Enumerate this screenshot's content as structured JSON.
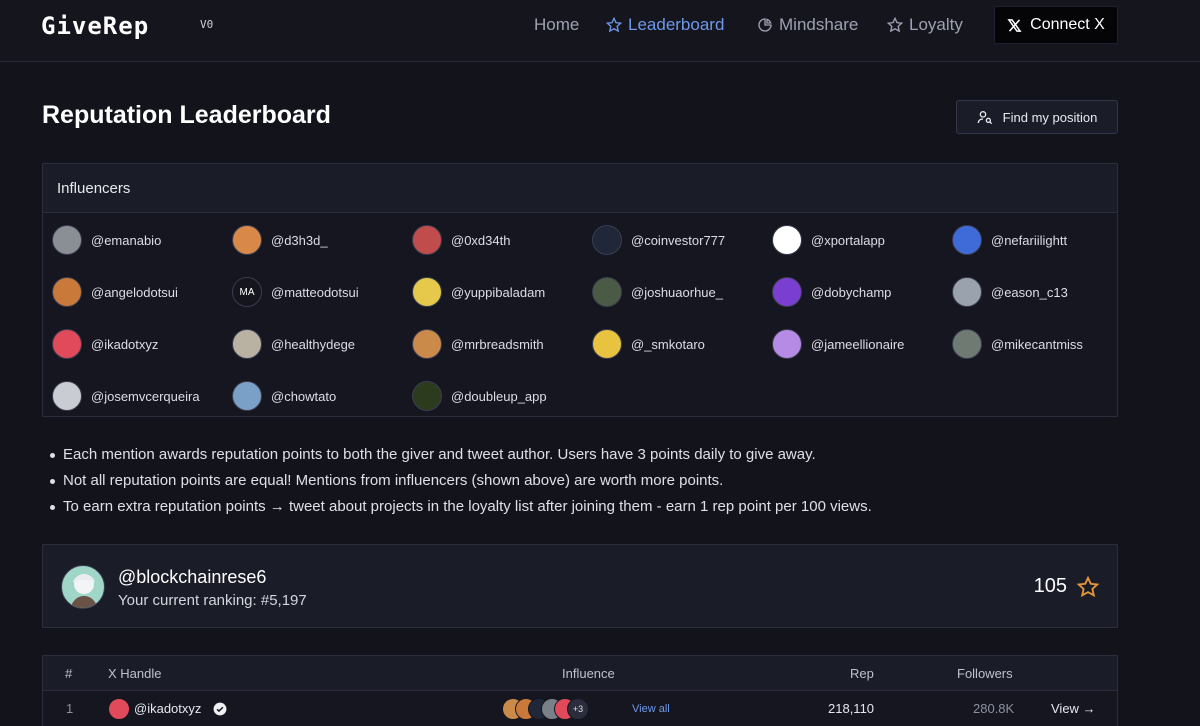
{
  "nav": {
    "logo": "GiveRep",
    "version": "V0",
    "links": [
      {
        "label": "Home",
        "icon": "none",
        "active": false
      },
      {
        "label": "Leaderboard",
        "icon": "star-icon",
        "active": true
      },
      {
        "label": "Mindshare",
        "icon": "pie-chart-icon",
        "active": false
      },
      {
        "label": "Loyalty",
        "icon": "star-icon",
        "active": false
      }
    ],
    "connect_label": "Connect X",
    "accent": "#6f98ea"
  },
  "page": {
    "title": "Reputation Leaderboard",
    "find_button": "Find my position"
  },
  "influencers": {
    "heading": "Influencers",
    "items": [
      {
        "handle": "@emanabio",
        "color": "#8a8f96"
      },
      {
        "handle": "@d3h3d_",
        "color": "#d8894a"
      },
      {
        "handle": "@0xd34th",
        "color": "#c14c4c"
      },
      {
        "handle": "@coinvestor777",
        "color": "#1f2738"
      },
      {
        "handle": "@xportalapp",
        "color": "#ffffff"
      },
      {
        "handle": "@nefariilightt",
        "color": "#3f6bd8"
      },
      {
        "handle": "@angelodotsui",
        "color": "#c97a3a"
      },
      {
        "handle": "@matteodotsui",
        "color": "#14151d",
        "initials": "MA"
      },
      {
        "handle": "@yuppibaladam",
        "color": "#e6c84a"
      },
      {
        "handle": "@joshuaorhue_",
        "color": "#4b5a45"
      },
      {
        "handle": "@dobychamp",
        "color": "#7a3fd0"
      },
      {
        "handle": "@eason_c13",
        "color": "#9aa3ad"
      },
      {
        "handle": "@ikadotxyz",
        "color": "#e04a5a"
      },
      {
        "handle": "@healthydege",
        "color": "#b9b2a2"
      },
      {
        "handle": "@mrbreadsmith",
        "color": "#c98a4a"
      },
      {
        "handle": "@_smkotaro",
        "color": "#e8c340"
      },
      {
        "handle": "@jameellionaire",
        "color": "#b58be6"
      },
      {
        "handle": "@mikecantmiss",
        "color": "#6f7a72"
      },
      {
        "handle": "@josemvcerqueira",
        "color": "#c9ccd2"
      },
      {
        "handle": "@chowtato",
        "color": "#7aa0c8"
      },
      {
        "handle": "@doubleup_app",
        "color": "#2c3a1e"
      }
    ]
  },
  "rules": [
    "Each mention awards reputation points to both the giver and tweet author. Users have 3 points daily to give away.",
    "Not all reputation points are equal! Mentions from influencers (shown above) are worth more points.",
    "To earn extra reputation points → tweet about projects in the loyalty list after joining them - earn 1 rep point per 100 views."
  ],
  "user": {
    "handle": "@blockchainrese6",
    "ranking": "Your current ranking: #5,197",
    "score": "105",
    "star_color": "#e8963a"
  },
  "table": {
    "headers": {
      "rank": "#",
      "handle": "X Handle",
      "influence": "Influence",
      "rep": "Rep",
      "followers": "Followers"
    },
    "rows": [
      {
        "rank": "1",
        "handle": "@ikadotxyz",
        "avatar_color": "#e04a5a",
        "influence_colors": [
          "#c98a4a",
          "#c97a3a",
          "#1f2738",
          "#7a8088",
          "#e04a5a"
        ],
        "influence_more": "+3",
        "view_all": "View all",
        "rep": "218,110",
        "followers": "280.8K",
        "view": "View →"
      }
    ]
  }
}
